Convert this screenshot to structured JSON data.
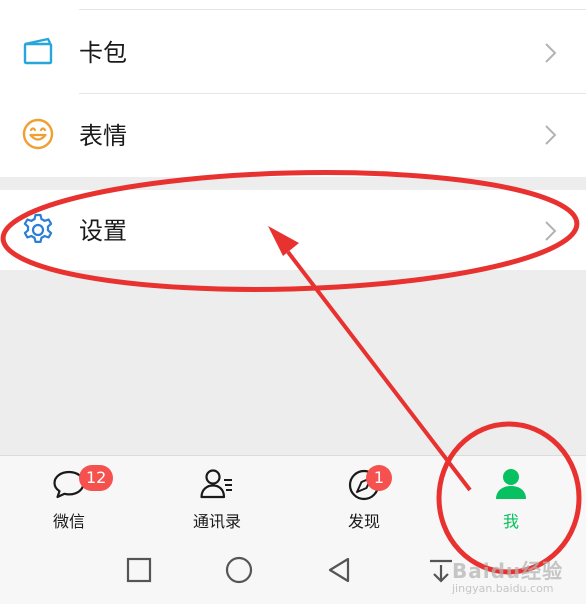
{
  "menu": {
    "items": [
      {
        "label": "卡包",
        "icon": "card-wallet-icon"
      },
      {
        "label": "表情",
        "icon": "sticker-smile-icon"
      },
      {
        "label": "设置",
        "icon": "gear-icon"
      }
    ]
  },
  "tabbar": {
    "tabs": [
      {
        "label": "微信",
        "icon": "chat-bubble-icon",
        "badge": "12"
      },
      {
        "label": "通讯录",
        "icon": "contacts-icon"
      },
      {
        "label": "发现",
        "icon": "compass-icon",
        "badge": "1"
      },
      {
        "label": "我",
        "icon": "person-icon",
        "active": true
      }
    ]
  },
  "navbar": {
    "buttons": [
      "recents-square-icon",
      "home-circle-icon",
      "back-triangle-icon",
      "notification-pull-icon"
    ]
  },
  "watermark": {
    "text": "Baidu经验",
    "sub": "jingyan.baidu.com"
  },
  "colors": {
    "accent_green": "#07c160",
    "badge_red": "#f5524f",
    "annotation_red": "#e8322f",
    "card_icon_blue": "#27a6d9",
    "smile_orange": "#f0a033",
    "gear_blue": "#2b7fd6"
  }
}
